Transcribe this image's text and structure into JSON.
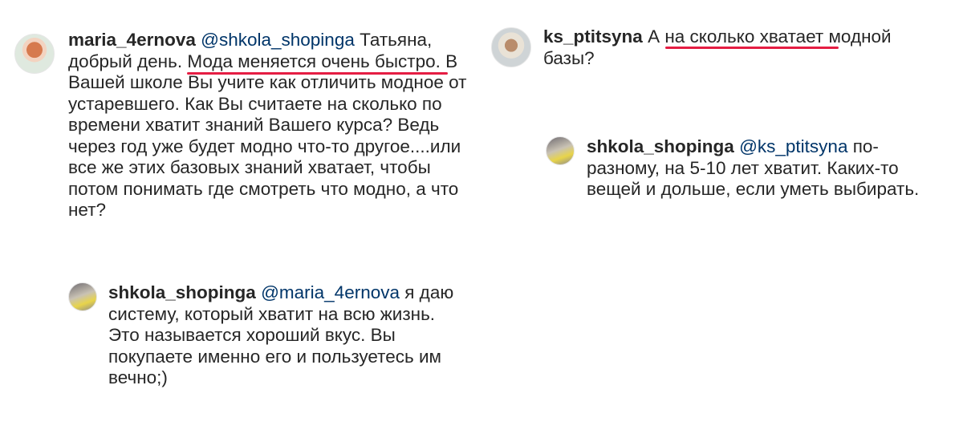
{
  "comments": [
    {
      "username": "maria_4ernova",
      "mention": "@shkola_shopinga",
      "text_before": " Татьяна, добрый день. ",
      "highlight": "Мода меняется очень быстро.",
      "text_after": " В Вашей школе Вы учите как отличить модное от устаревшего. Как Вы считаете на сколько по времени хватит знаний Вашего курса? Ведь через год уже будет модно что-то другое....или все же этих базовых знаний хватает, чтобы потом понимать где смотреть что модно, а что нет?",
      "avatar_icon": "profile-photo-maria"
    },
    {
      "username": "shkola_shopinga",
      "mention": "@maria_4ernova",
      "text": " я даю систему, который хватит на всю жизнь. Это называется хороший вкус. Вы покупаете именно его и пользуетесь им вечно;)",
      "avatar_icon": "profile-photo-shkola"
    },
    {
      "username": "ks_ptitsyna",
      "text_before": " А ",
      "highlight": "на сколько хватает",
      "text_after": " модной базы?",
      "avatar_icon": "profile-photo-ks"
    },
    {
      "username": "shkola_shopinga",
      "mention": "@ks_ptitsyna",
      "text": " по-разному, на 5-10 лет хватит. Каких-то вещей и дольше, если уметь выбирать.",
      "avatar_icon": "profile-photo-shkola"
    }
  ],
  "colors": {
    "underline": "#e51d43",
    "mention": "#003569",
    "text": "#262626"
  }
}
